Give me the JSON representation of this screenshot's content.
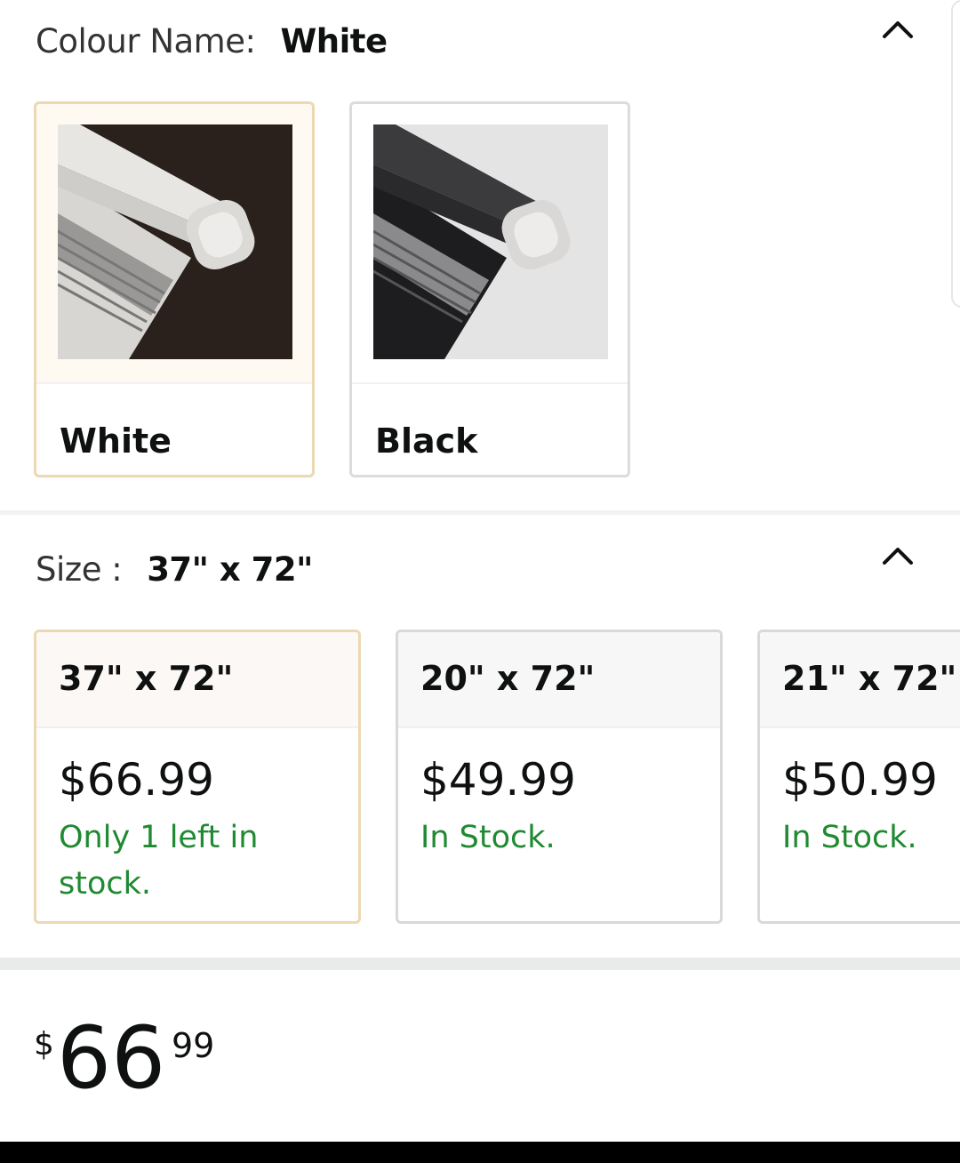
{
  "colour": {
    "label": "Colour Name:",
    "selected": "White",
    "options": [
      {
        "name": "White",
        "selected": true
      },
      {
        "name": "Black",
        "selected": false
      }
    ],
    "collapse_icon": "chevron-up-icon"
  },
  "size": {
    "label": "Size :",
    "selected": "37\" x 72\"",
    "collapse_icon": "chevron-up-icon",
    "options": [
      {
        "dims": "37\" x 72\"",
        "price": "$66.99",
        "stock": "Only 1 left in stock.",
        "selected": true
      },
      {
        "dims": "20\" x 72\"",
        "price": "$49.99",
        "stock": "In Stock.",
        "selected": false
      },
      {
        "dims": "21\" x 72\"",
        "price": "$50.99",
        "stock": "In Stock.",
        "selected": false
      }
    ]
  },
  "price": {
    "symbol": "$",
    "whole": "66",
    "fraction": "99"
  },
  "colors": {
    "stock_green": "#1f8a31",
    "selected_border": "#ecd9b4",
    "text": "#0f1111"
  }
}
